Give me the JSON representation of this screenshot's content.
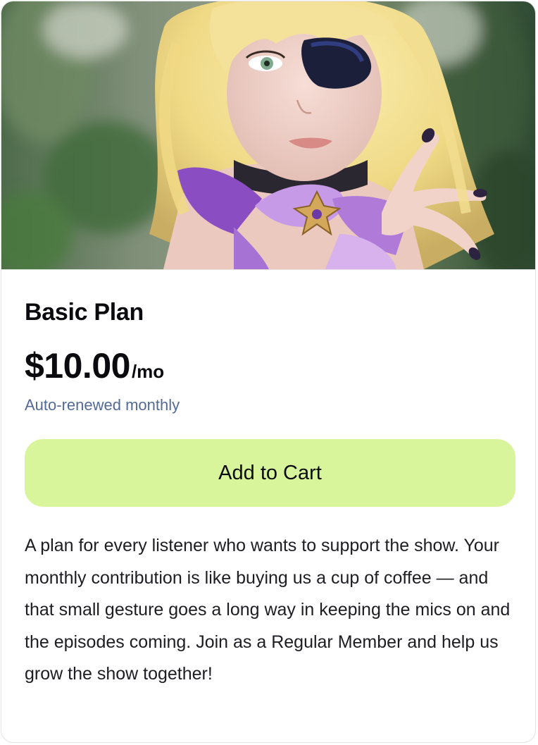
{
  "product": {
    "image_alt": "Cosplayer with blonde hair, an eyepatch and a purple bow",
    "name": "Basic Plan",
    "price": "$10.00",
    "period": "/mo",
    "renewal_note": "Auto-renewed monthly",
    "cta_label": "Add to Cart",
    "description": "A plan for every listener who wants to support the show. Your monthly contribution is like buying us a cup of coffee — and that small gesture goes a long way in keeping the mics on and the episodes coming. Join as a Regular Member and help us grow the show together!"
  },
  "colors": {
    "cta_background": "#d9f59c",
    "renewal_text": "#536a96",
    "title_text": "#0b0b0f",
    "card_border": "#e3e3e6"
  }
}
